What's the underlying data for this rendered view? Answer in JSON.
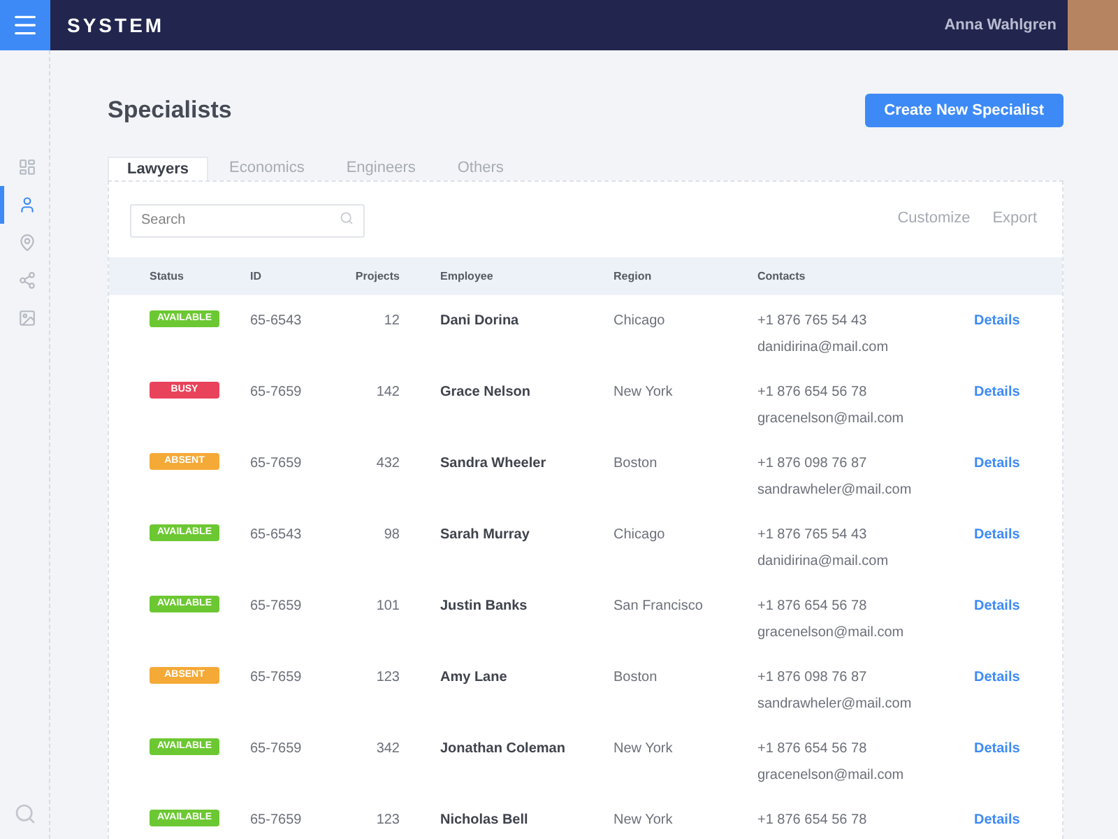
{
  "topbar": {
    "title": "SYSTEM",
    "user_name": "Anna Wahlgren"
  },
  "sidebar": {
    "items": [
      {
        "kind": "dashboard",
        "selected": false
      },
      {
        "kind": "user",
        "selected": true
      },
      {
        "kind": "location",
        "selected": false
      },
      {
        "kind": "share",
        "selected": false
      },
      {
        "kind": "image",
        "selected": false
      }
    ]
  },
  "page": {
    "title": "Specialists",
    "create_button": "Create New Specialist"
  },
  "tabs": [
    {
      "label": "Lawyers",
      "selected": true
    },
    {
      "label": "Economics",
      "selected": false
    },
    {
      "label": "Engineers",
      "selected": false
    },
    {
      "label": "Others",
      "selected": false
    }
  ],
  "toolbar": {
    "search_placeholder": "Search",
    "actions": [
      "Customize",
      "Export"
    ]
  },
  "table": {
    "columns": [
      "Status",
      "ID",
      "Projects",
      "Employee",
      "Region",
      "Contacts"
    ],
    "rows": [
      {
        "status": {
          "label": "AVAILABLE",
          "color": "#6cc832"
        },
        "id": "65-6543",
        "projects": "12",
        "employee": "Dani Dorina",
        "region": "Chicago",
        "phone": "+1 876 765 54 43",
        "email": "danidirina@mail.com",
        "link": "Details"
      },
      {
        "status": {
          "label": "BUSY",
          "color": "#e8435a"
        },
        "id": "65-7659",
        "projects": "142",
        "employee": "Grace Nelson",
        "region": "New York",
        "phone": "+1 876 654 56 78",
        "email": "gracenelson@mail.com",
        "link": "Details"
      },
      {
        "status": {
          "label": "ABSENT",
          "color": "#f5a936"
        },
        "id": "65-7659",
        "projects": "432",
        "employee": "Sandra Wheeler",
        "region": "Boston",
        "phone": "+1 876 098 76 87",
        "email": "sandrawheler@mail.com",
        "link": "Details"
      },
      {
        "status": {
          "label": "AVAILABLE",
          "color": "#6cc832"
        },
        "id": "65-6543",
        "projects": "98",
        "employee": "Sarah Murray",
        "region": "Chicago",
        "phone": "+1 876 765 54 43",
        "email": "danidirina@mail.com",
        "link": "Details"
      },
      {
        "status": {
          "label": "AVAILABLE",
          "color": "#6cc832"
        },
        "id": "65-7659",
        "projects": "101",
        "employee": "Justin Banks",
        "region": "San Francisco",
        "phone": "+1 876 654 56 78",
        "email": "gracenelson@mail.com",
        "link": "Details"
      },
      {
        "status": {
          "label": "ABSENT",
          "color": "#f5a936"
        },
        "id": "65-7659",
        "projects": "123",
        "employee": "Amy Lane",
        "region": "Boston",
        "phone": "+1 876 098 76 87",
        "email": "sandrawheler@mail.com",
        "link": "Details"
      },
      {
        "status": {
          "label": "AVAILABLE",
          "color": "#6cc832"
        },
        "id": "65-7659",
        "projects": "342",
        "employee": "Jonathan Coleman",
        "region": "New York",
        "phone": "+1 876 654 56 78",
        "email": "gracenelson@mail.com",
        "link": "Details"
      },
      {
        "status": {
          "label": "AVAILABLE",
          "color": "#6cc832"
        },
        "id": "65-7659",
        "projects": "123",
        "employee": "Nicholas Bell",
        "region": "New York",
        "phone": "+1 876 654 56 78",
        "link": "Details"
      }
    ]
  }
}
